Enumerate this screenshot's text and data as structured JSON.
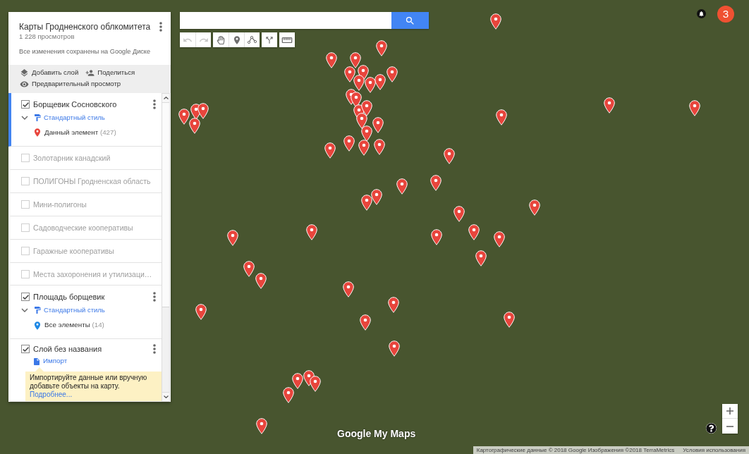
{
  "panel": {
    "title": "Карты Гродненского облкомитета",
    "views": "1 228 просмотров",
    "saved": "Все изменения сохранены на Google Диске",
    "actions": [
      {
        "kind": "add_layer",
        "label": "Добавить слой"
      },
      {
        "kind": "share",
        "label": "Поделиться"
      },
      {
        "kind": "preview",
        "label": "Предварительный просмотр"
      }
    ],
    "layers": [
      {
        "kind": "styled",
        "name": "Борщевик Сосновского",
        "checked": true,
        "selected": true,
        "style": "Стандартный стиль",
        "items_label": "Данный элемент",
        "count": "(427)",
        "color": "#e8453c"
      },
      {
        "kind": "plain",
        "name": "Золотарник канадский",
        "checked": false,
        "selected": false
      },
      {
        "kind": "plain",
        "name": "ПОЛИГОНЫ Гродненская область",
        "checked": false,
        "selected": false
      },
      {
        "kind": "plain",
        "name": "Мини-полигоны",
        "checked": false,
        "selected": false
      },
      {
        "kind": "plain",
        "name": "Садоводческие кооперативы",
        "checked": false,
        "selected": false
      },
      {
        "kind": "plain",
        "name": "Гаражные кооперативы",
        "checked": false,
        "selected": false
      },
      {
        "kind": "plain",
        "name": "Места захоронения и утилизаци…",
        "checked": false,
        "selected": false
      },
      {
        "kind": "styled",
        "name": "Площадь борщевик",
        "checked": true,
        "selected": false,
        "style": "Стандартный стиль",
        "items_label": "Все элементы",
        "count": "(14)",
        "color": "#1e88e5"
      },
      {
        "kind": "import",
        "name": "Слой без названия",
        "checked": true,
        "selected": false,
        "import_label": "Импорт",
        "tip": "Импортируйте данные или вручную добавьте объекты на карту.",
        "tip_link": "Подробнее..."
      }
    ]
  },
  "toolbar": [
    {
      "tools": [
        {
          "kind": "undo",
          "disabled": true
        },
        {
          "kind": "redo",
          "disabled": true
        }
      ]
    },
    {
      "tools": [
        {
          "kind": "hand",
          "disabled": false
        },
        {
          "kind": "marker",
          "disabled": false
        },
        {
          "kind": "line",
          "disabled": false
        }
      ]
    },
    {
      "tools": [
        {
          "kind": "route",
          "disabled": false
        }
      ]
    },
    {
      "tools": [
        {
          "kind": "ruler",
          "disabled": false
        }
      ]
    }
  ],
  "account": {
    "initial": "З"
  },
  "logo": "Google My Maps",
  "attribution": {
    "data": "Картографические данные © 2018 Google Изображения ©2018 TerraMetrics",
    "terms": "Условия использования"
  }
}
